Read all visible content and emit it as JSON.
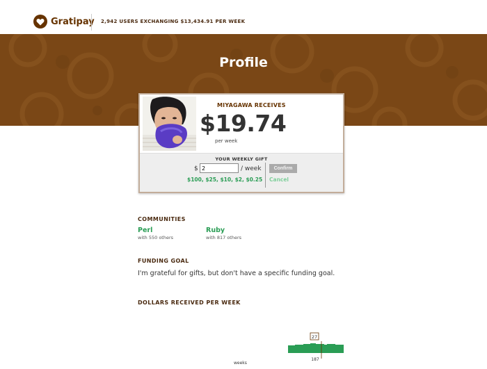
{
  "header": {
    "brand": "Gratipay",
    "tagline": "2,942 USERS EXCHANGING $13,434.91 PER WEEK"
  },
  "hero": {
    "title": "Profile"
  },
  "profile": {
    "receives_label": "MIYAGAWA RECEIVES",
    "amount": "$19.74",
    "per_week": "per week"
  },
  "gift": {
    "title": "YOUR WEEKLY GIFT",
    "currency_symbol": "$",
    "value": "2",
    "unit": "/ week",
    "confirm_label": "Confirm",
    "cancel_label": "Cancel",
    "suggestions": "$100, $25, $10, $2, $0.25"
  },
  "communities": {
    "heading": "COMMUNITIES",
    "items": [
      {
        "name": "Perl",
        "count": "with 550 others"
      },
      {
        "name": "Ruby",
        "count": "with 817 others"
      }
    ]
  },
  "funding": {
    "heading": "FUNDING GOAL",
    "text": "I'm grateful for gifts, but don't have a specific funding goal."
  },
  "chart_section": {
    "heading": "DOLLARS RECEIVED PER WEEK"
  },
  "chart_data": {
    "type": "bar",
    "xlabel": "weeks",
    "ylabel": "",
    "hover_value_label": "27",
    "hover_week_label": "187",
    "values": [
      11,
      11,
      11,
      11,
      11,
      12,
      12,
      12,
      12,
      12,
      12,
      13,
      13,
      13,
      13,
      13,
      14,
      14,
      14,
      14,
      13,
      13,
      13,
      13,
      13,
      13,
      12,
      12,
      13,
      13,
      13,
      13,
      13,
      13,
      12,
      12,
      12,
      12,
      12,
      12
    ],
    "colors": {
      "bar": "#2a9d55",
      "hover": "#663300"
    }
  },
  "colors": {
    "brand": "#663300",
    "hero": "#7a4716",
    "link_green": "#2a9d55"
  }
}
